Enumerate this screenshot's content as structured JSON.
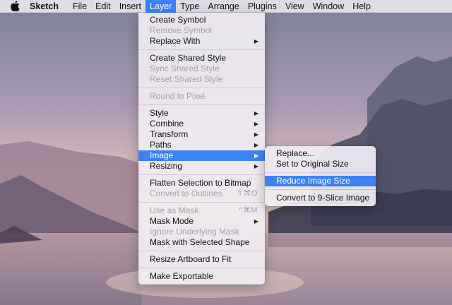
{
  "menubar": {
    "apple_icon": "apple-logo-icon",
    "app_name": "Sketch",
    "items": [
      "File",
      "Edit",
      "Insert",
      "Layer",
      "Type",
      "Arrange",
      "Plugins",
      "View",
      "Window",
      "Help"
    ],
    "active_item": "Layer"
  },
  "layer_menu": {
    "items": [
      {
        "label": "Create Symbol",
        "enabled": true
      },
      {
        "label": "Remove Symbol",
        "enabled": false
      },
      {
        "label": "Replace With",
        "enabled": true,
        "submenu": true
      },
      {
        "separator": true
      },
      {
        "label": "Create Shared Style",
        "enabled": true
      },
      {
        "label": "Sync Shared Style",
        "enabled": false
      },
      {
        "label": "Reset Shared Style",
        "enabled": false
      },
      {
        "separator": true
      },
      {
        "label": "Round to Pixel",
        "enabled": false
      },
      {
        "separator": true
      },
      {
        "label": "Style",
        "enabled": true,
        "submenu": true
      },
      {
        "label": "Combine",
        "enabled": true,
        "submenu": true
      },
      {
        "label": "Transform",
        "enabled": true,
        "submenu": true
      },
      {
        "label": "Paths",
        "enabled": true,
        "submenu": true
      },
      {
        "label": "Image",
        "enabled": true,
        "submenu": true,
        "highlighted": true
      },
      {
        "label": "Resizing",
        "enabled": true,
        "submenu": true
      },
      {
        "separator": true
      },
      {
        "label": "Flatten Selection to Bitmap",
        "enabled": true
      },
      {
        "label": "Convert to Outlines",
        "enabled": false,
        "shortcut": "⇧⌘O"
      },
      {
        "separator": true
      },
      {
        "label": "Use as Mask",
        "enabled": false,
        "shortcut": "^⌘M"
      },
      {
        "label": "Mask Mode",
        "enabled": true,
        "submenu": true
      },
      {
        "label": "Ignore Underlying Mask",
        "enabled": false
      },
      {
        "label": "Mask with Selected Shape",
        "enabled": true
      },
      {
        "separator": true
      },
      {
        "label": "Resize Artboard to Fit",
        "enabled": true
      },
      {
        "separator": true
      },
      {
        "label": "Make Exportable",
        "enabled": true
      }
    ]
  },
  "image_submenu": {
    "items": [
      {
        "label": "Replace...",
        "enabled": true
      },
      {
        "label": "Set to Original Size",
        "enabled": true
      },
      {
        "separator": true
      },
      {
        "label": "Reduce Image Size",
        "enabled": true,
        "highlighted": true
      },
      {
        "separator": true
      },
      {
        "label": "Convert to 9-Slice Image",
        "enabled": true
      }
    ]
  },
  "colors": {
    "highlight": "#3b82f7",
    "menu_bg": "#f0ecf2",
    "disabled_text": "#a49fa9"
  }
}
